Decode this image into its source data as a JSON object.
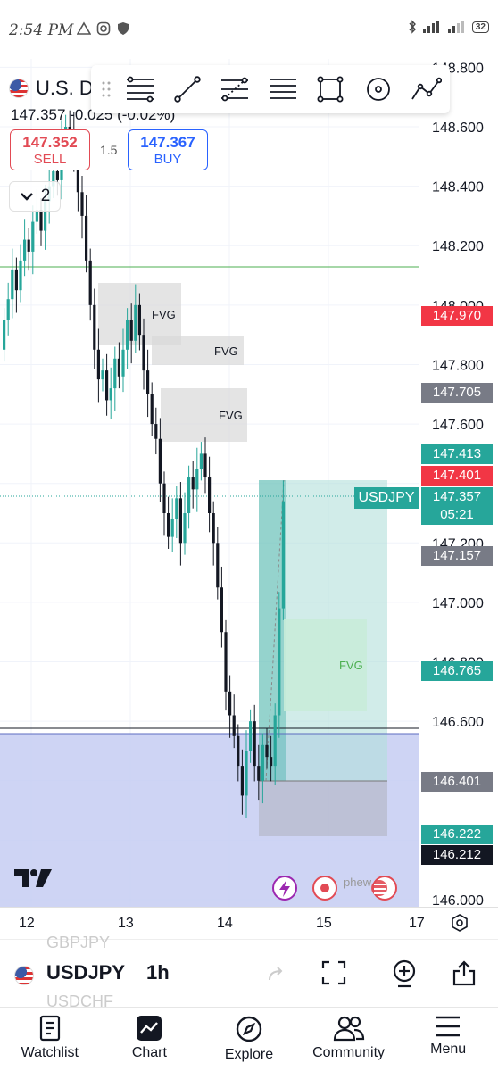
{
  "status_bar": {
    "time": "2:54 PM",
    "battery": "32"
  },
  "symbol": {
    "name": "U.S. D",
    "price_line": "147.357  -0.025 (-0.02%)"
  },
  "trade": {
    "sell_price": "147.352",
    "sell_label": "SELL",
    "spread": "1.5",
    "buy_price": "147.367",
    "buy_label": "BUY"
  },
  "collapse": {
    "count": "2"
  },
  "y_axis": {
    "ticks": [
      "148.800",
      "148.600",
      "148.400",
      "148.200",
      "148.000",
      "147.800",
      "147.600",
      "147.200",
      "147.000",
      "146.800",
      "146.600",
      "146.000"
    ],
    "tags": [
      {
        "value": "147.970",
        "color": "#f23645"
      },
      {
        "value": "147.705",
        "color": "#787b86"
      },
      {
        "value": "147.413",
        "color": "#26a69a"
      },
      {
        "value": "147.401",
        "color": "#f23645"
      },
      {
        "value": "147.157",
        "color": "#787b86"
      },
      {
        "value": "146.765",
        "color": "#26a69a"
      },
      {
        "value": "146.401",
        "color": "#787b86"
      },
      {
        "value": "146.222",
        "color": "#26a69a"
      },
      {
        "value": "146.212",
        "color": "#131722"
      }
    ],
    "current": {
      "symbol": "USDJPY",
      "price": "147.357",
      "countdown": "05:21"
    }
  },
  "fvg_labels": [
    "FVG",
    "FVG",
    "FVG",
    "FVG"
  ],
  "x_axis": {
    "labels": [
      "12",
      "13",
      "14",
      "15",
      "17"
    ]
  },
  "bottom_bar": {
    "prev_symbol": "GBPJPY",
    "symbol": "USDJPY",
    "next_symbol": "USDCHF",
    "interval": "1h"
  },
  "nav": [
    {
      "label": "Watchlist",
      "icon": "watchlist-icon"
    },
    {
      "label": "Chart",
      "icon": "chart-icon"
    },
    {
      "label": "Explore",
      "icon": "compass-icon"
    },
    {
      "label": "Community",
      "icon": "community-icon"
    },
    {
      "label": "Menu",
      "icon": "menu-icon"
    }
  ],
  "colors": {
    "up": "#26a69a",
    "down": "#131722",
    "sell": "#e24a54",
    "buy": "#2962ff",
    "zone": "#c5cdf2"
  }
}
